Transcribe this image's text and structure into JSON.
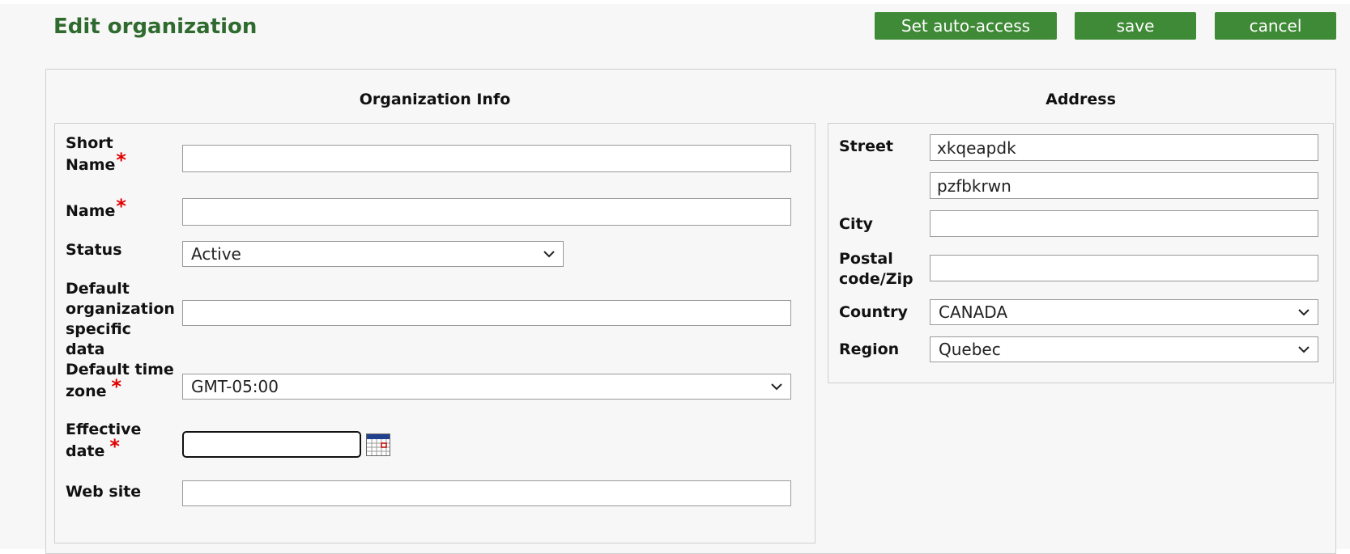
{
  "header": {
    "title": "Edit organization",
    "buttons": {
      "auto_access": "Set auto-access",
      "save": "save",
      "cancel": "cancel"
    }
  },
  "org_info": {
    "heading": "Organization Info",
    "short_name": {
      "label_line1": "Short",
      "label_line2": "Name",
      "value": ""
    },
    "name": {
      "label": "Name",
      "value": ""
    },
    "status": {
      "label": "Status",
      "value": "Active"
    },
    "default_org_data": {
      "label_lines": [
        "Default",
        "organization",
        "specific",
        "data"
      ],
      "value": ""
    },
    "time_zone": {
      "label_line1": "Default time",
      "label_line2": "zone",
      "value": "GMT-05:00"
    },
    "effective_date": {
      "label_line1": "Effective",
      "label_line2": "date",
      "value": ""
    },
    "web_site": {
      "label": "Web site",
      "value": ""
    },
    "required_mark": "*"
  },
  "address": {
    "heading": "Address",
    "street": {
      "label": "Street",
      "line1": "xkqeapdk",
      "line2": "pzfbkrwn"
    },
    "city": {
      "label": "City",
      "value": ""
    },
    "postal": {
      "label_line1": "Postal",
      "label_line2": "code/Zip",
      "value": ""
    },
    "country": {
      "label": "Country",
      "value": "CANADA"
    },
    "region": {
      "label": "Region",
      "value": "Quebec"
    }
  },
  "colors": {
    "accent": "#3f8a36",
    "title": "#2f6b2f",
    "required": "#e00000"
  },
  "icons": {
    "dropdown": "chevron-down-icon",
    "calendar": "calendar-icon"
  }
}
